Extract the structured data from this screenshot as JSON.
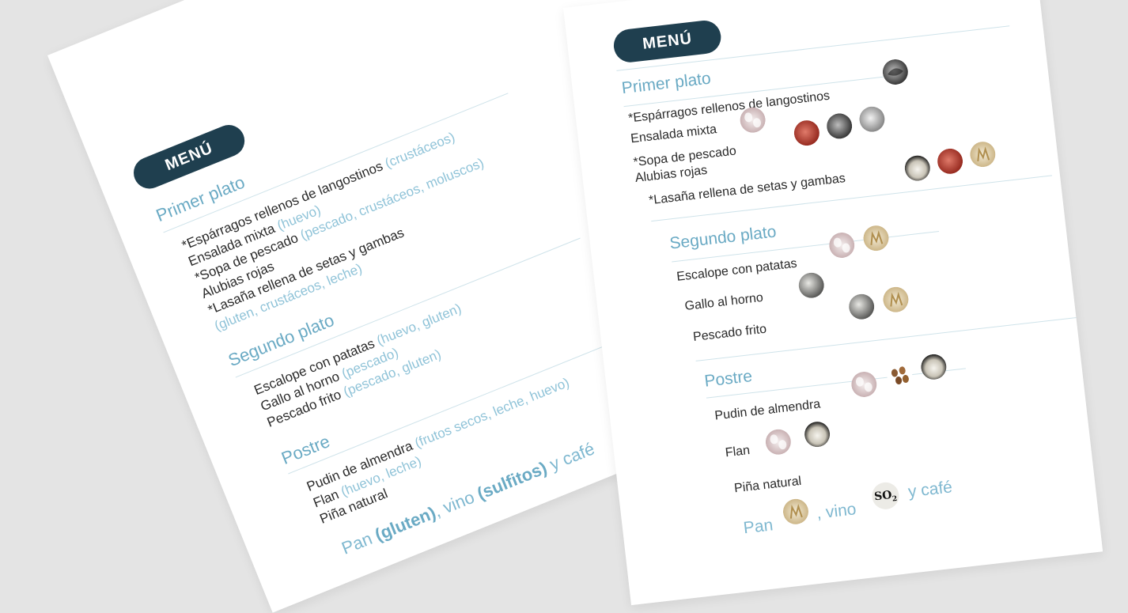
{
  "left_menu": {
    "badge": "MENÚ",
    "primer_title": "Primer plato",
    "primer_items": [
      {
        "name": "*Espárragos rellenos de langostinos",
        "allergens": "(crustáceos)"
      },
      {
        "name": "Ensalada mixta",
        "allergens": "(huevo)"
      },
      {
        "name": "*Sopa de pescado",
        "allergens": "(pescado, crustáceos, moluscos)"
      },
      {
        "name": "Alubias rojas",
        "allergens": ""
      },
      {
        "name": "*Lasaña rellena de setas y gambas",
        "allergens": ""
      },
      {
        "name": "",
        "allergens": "(gluten, crustáceos, leche)"
      }
    ],
    "segundo_title": "Segundo plato",
    "segundo_items": [
      {
        "name": "Escalope con patatas",
        "allergens": "(huevo, gluten)"
      },
      {
        "name": "Gallo al horno",
        "allergens": "(pescado)"
      },
      {
        "name": "Pescado frito",
        "allergens": "(pescado, gluten)"
      }
    ],
    "postre_title": "Postre",
    "postre_items": [
      {
        "name": "Pudin de almendra",
        "allergens": "(frutos secos, leche, huevo)"
      },
      {
        "name": "Flan",
        "allergens": "(huevo, leche)"
      },
      {
        "name": "Piña natural",
        "allergens": ""
      }
    ],
    "footer": {
      "pan": "Pan ",
      "gluten": "(gluten)",
      "vino": ", vino ",
      "sulfitos": "(sulfitos)",
      "cafe": " y café"
    }
  },
  "right_menu": {
    "badge": "MENÚ",
    "primer_title": "Primer plato",
    "primer_items": [
      {
        "name": "*Espárragos rellenos de langostinos",
        "icons": [
          "crustaceans-icon"
        ]
      },
      {
        "name": "Ensalada mixta",
        "icons": [
          "egg-icon"
        ]
      },
      {
        "name": "*Sopa de pescado",
        "icons": [
          "fish-icon",
          "crustaceans-icon",
          "mollusc-icon"
        ]
      },
      {
        "name": "Alubias rojas",
        "icons": []
      },
      {
        "name": "*Lasaña rellena de setas y gambas",
        "icons": [
          "milk-icon",
          "crustaceans-icon",
          "gluten-icon"
        ]
      }
    ],
    "segundo_title": "Segundo plato",
    "segundo_items": [
      {
        "name": "Escalope con patatas",
        "icons": [
          "egg-icon",
          "gluten-icon"
        ]
      },
      {
        "name": "Gallo al horno",
        "icons": [
          "fish-icon"
        ]
      },
      {
        "name": "Pescado frito",
        "icons": [
          "fish-icon",
          "gluten-icon"
        ]
      }
    ],
    "postre_title": "Postre",
    "postre_items": [
      {
        "name": "Pudin de almendra",
        "icons": [
          "egg-icon",
          "nuts-icon",
          "milk-icon"
        ]
      },
      {
        "name": "Flan",
        "icons": [
          "egg-icon",
          "milk-icon"
        ]
      },
      {
        "name": "Piña natural",
        "icons": []
      }
    ],
    "footer": {
      "pan": "Pan",
      "vino": ", vino",
      "so2": "SO",
      "so2_sub": "2",
      "cafe": "y café"
    }
  },
  "colors": {
    "badge_bg": "#1f3f4f",
    "section_title": "#6aaac4",
    "allergen_text": "#8fc3d8",
    "background": "#e4e4e4"
  }
}
